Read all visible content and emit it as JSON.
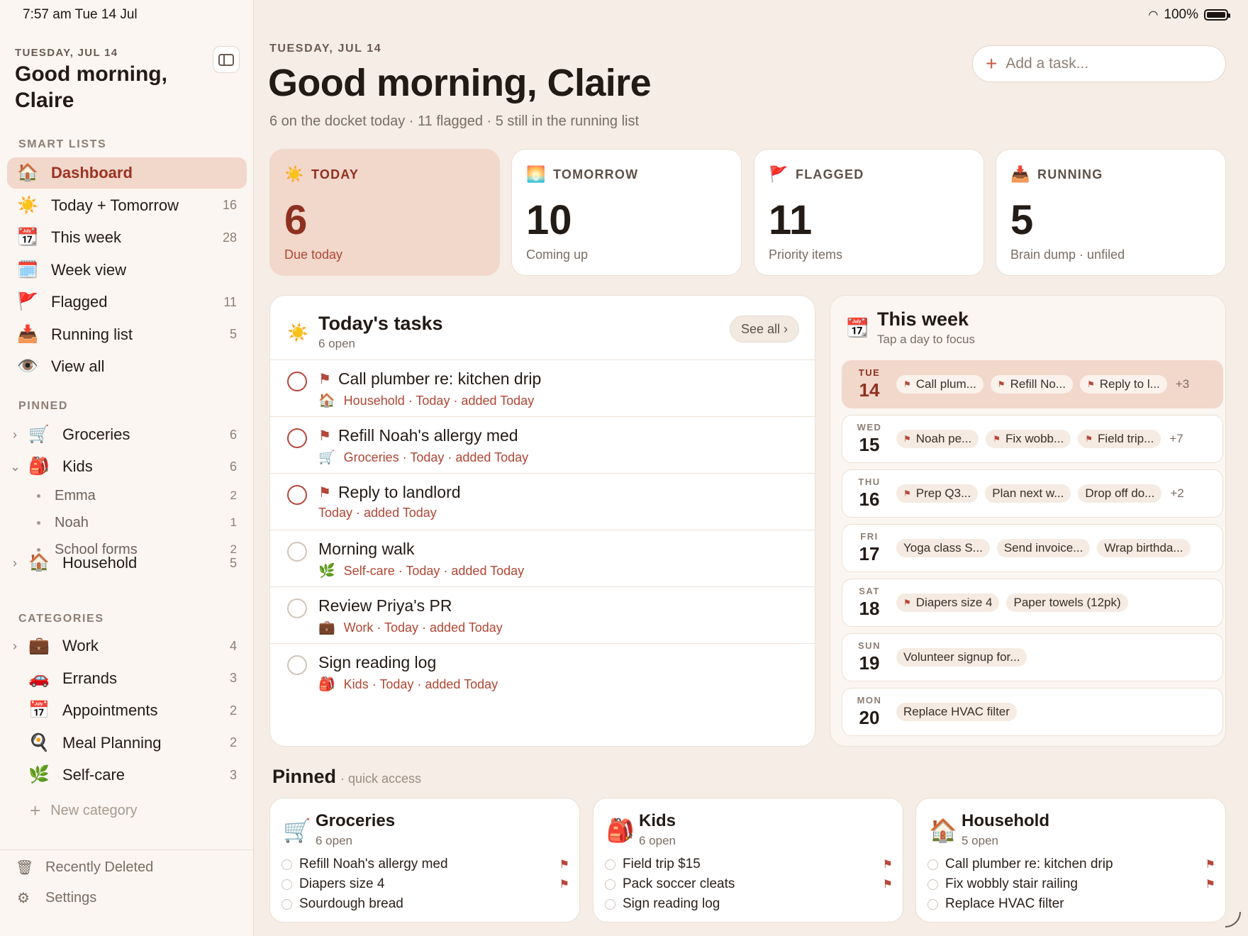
{
  "status_bar": {
    "time": "7:57 am   Tue 14 Jul",
    "battery": "100%"
  },
  "sidebar": {
    "date": "TUESDAY, JUL 14",
    "greeting": "Good morning, Claire",
    "smart_label": "SMART LISTS",
    "smart": [
      {
        "icon": "🏠",
        "label": "Dashboard",
        "count": ""
      },
      {
        "icon": "☀️",
        "label": "Today + Tomorrow",
        "count": "16"
      },
      {
        "icon": "📆",
        "label": "This week",
        "count": "28"
      },
      {
        "icon": "🗓️",
        "label": "Week view",
        "count": ""
      },
      {
        "icon": "🚩",
        "label": "Flagged",
        "count": "11"
      },
      {
        "icon": "📥",
        "label": "Running list",
        "count": "5"
      },
      {
        "icon": "👁️",
        "label": "View all",
        "count": ""
      }
    ],
    "pinned_label": "PINNED",
    "pinned": [
      {
        "chev": "›",
        "icon": "🛒",
        "label": "Groceries",
        "count": "6"
      },
      {
        "chev": "⌄",
        "icon": "🎒",
        "label": "Kids",
        "count": "6"
      },
      {
        "chev": "›",
        "icon": "🏠",
        "label": "Household",
        "count": "5"
      }
    ],
    "kids_children": [
      {
        "label": "Emma",
        "count": "2"
      },
      {
        "label": "Noah",
        "count": "1"
      },
      {
        "label": "School forms",
        "count": "2"
      }
    ],
    "categories_label": "CATEGORIES",
    "categories": [
      {
        "chev": "›",
        "icon": "💼",
        "label": "Work",
        "count": "4"
      },
      {
        "chev": "",
        "icon": "🚗",
        "label": "Errands",
        "count": "3"
      },
      {
        "chev": "",
        "icon": "📅",
        "label": "Appointments",
        "count": "2"
      },
      {
        "chev": "",
        "icon": "🍳",
        "label": "Meal Planning",
        "count": "2"
      },
      {
        "chev": "",
        "icon": "🌿",
        "label": "Self-care",
        "count": "3"
      }
    ],
    "new_category": "New category",
    "recently_deleted": "Recently Deleted",
    "settings": "Settings"
  },
  "header": {
    "date": "TUESDAY, JUL 14",
    "title": "Good morning, Claire",
    "subtitle": "6 on the docket today · 11 flagged · 5 still in the running list",
    "add_placeholder": "Add a task..."
  },
  "cards": [
    {
      "icon": "☀️",
      "label": "TODAY",
      "value": "6",
      "caption": "Due today"
    },
    {
      "icon": "🌅",
      "label": "TOMORROW",
      "value": "10",
      "caption": "Coming up"
    },
    {
      "icon": "🚩",
      "label": "FLAGGED",
      "value": "11",
      "caption": "Priority items"
    },
    {
      "icon": "📥",
      "label": "RUNNING",
      "value": "5",
      "caption": "Brain dump · unfiled"
    }
  ],
  "today_panel": {
    "icon": "☀️",
    "title": "Today's tasks",
    "subtitle": "6 open",
    "see_all": "See all ›",
    "tasks": [
      {
        "flagged": true,
        "title": "Call plumber re: kitchen drip",
        "icon": "🏠",
        "meta": "Household · Today · added Today"
      },
      {
        "flagged": true,
        "title": "Refill Noah's allergy med",
        "icon": "🛒",
        "meta": "Groceries · Today · added Today"
      },
      {
        "flagged": true,
        "title": "Reply to landlord",
        "icon": "",
        "meta": "Today · added Today"
      },
      {
        "flagged": false,
        "title": "Morning walk",
        "icon": "🌿",
        "meta": "Self-care · Today · added Today"
      },
      {
        "flagged": false,
        "title": "Review Priya's PR",
        "icon": "💼",
        "meta": "Work · Today · added Today"
      },
      {
        "flagged": false,
        "title": "Sign reading log",
        "icon": "🎒",
        "meta": "Kids · Today · added Today"
      }
    ]
  },
  "week_panel": {
    "icon": "📆",
    "title": "This week",
    "subtitle": "Tap a day to focus",
    "days": [
      {
        "dow": "TUE",
        "day": "14",
        "more": "+3",
        "chips": [
          {
            "f": true,
            "t": "Call plum..."
          },
          {
            "f": true,
            "t": "Refill No..."
          },
          {
            "f": true,
            "t": "Reply to l..."
          }
        ]
      },
      {
        "dow": "WED",
        "day": "15",
        "more": "+7",
        "chips": [
          {
            "f": true,
            "t": "Noah pe..."
          },
          {
            "f": true,
            "t": "Fix wobb..."
          },
          {
            "f": true,
            "t": "Field trip..."
          }
        ]
      },
      {
        "dow": "THU",
        "day": "16",
        "more": "+2",
        "chips": [
          {
            "f": true,
            "t": "Prep Q3..."
          },
          {
            "f": false,
            "t": "Plan next w..."
          },
          {
            "f": false,
            "t": "Drop off do..."
          }
        ]
      },
      {
        "dow": "FRI",
        "day": "17",
        "more": "",
        "chips": [
          {
            "f": false,
            "t": "Yoga class S..."
          },
          {
            "f": false,
            "t": "Send invoice..."
          },
          {
            "f": false,
            "t": "Wrap birthda..."
          }
        ]
      },
      {
        "dow": "SAT",
        "day": "18",
        "more": "",
        "chips": [
          {
            "f": true,
            "t": "Diapers size 4"
          },
          {
            "f": false,
            "t": "Paper towels (12pk)"
          }
        ]
      },
      {
        "dow": "SUN",
        "day": "19",
        "more": "",
        "chips": [
          {
            "f": false,
            "t": "Volunteer signup for..."
          }
        ]
      },
      {
        "dow": "MON",
        "day": "20",
        "more": "",
        "chips": [
          {
            "f": false,
            "t": "Replace HVAC filter"
          }
        ]
      }
    ]
  },
  "pinned_section": {
    "title": "Pinned",
    "subtitle": "· quick access",
    "cards": [
      {
        "icon": "🛒",
        "title": "Groceries",
        "subtitle": "6 open",
        "items": [
          {
            "t": "Refill Noah's allergy med",
            "f": true
          },
          {
            "t": "Diapers size 4",
            "f": true
          },
          {
            "t": "Sourdough bread",
            "f": false
          }
        ]
      },
      {
        "icon": "🎒",
        "title": "Kids",
        "subtitle": "6 open",
        "items": [
          {
            "t": "Field trip $15",
            "f": true
          },
          {
            "t": "Pack soccer cleats",
            "f": true
          },
          {
            "t": "Sign reading log",
            "f": false
          }
        ]
      },
      {
        "icon": "🏠",
        "title": "Household",
        "subtitle": "5 open",
        "items": [
          {
            "t": "Call plumber re: kitchen drip",
            "f": true
          },
          {
            "t": "Fix wobbly stair railing",
            "f": true
          },
          {
            "t": "Replace HVAC filter",
            "f": false
          }
        ]
      }
    ]
  },
  "colors": {
    "accent": "#b6473a",
    "highlight": "#f2d7cb",
    "background": "#f5ede6"
  }
}
